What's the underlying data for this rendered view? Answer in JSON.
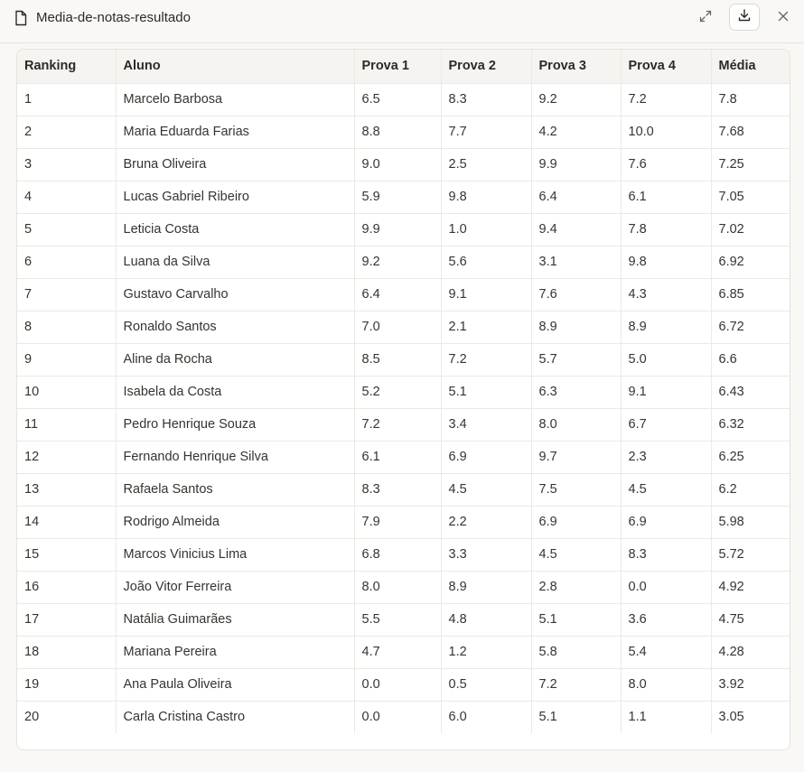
{
  "header": {
    "title": "Media-de-notas-resultado"
  },
  "table": {
    "columns": [
      "Ranking",
      "Aluno",
      "Prova 1",
      "Prova 2",
      "Prova 3",
      "Prova 4",
      "Média"
    ],
    "rows": [
      [
        "1",
        "Marcelo Barbosa",
        "6.5",
        "8.3",
        "9.2",
        "7.2",
        "7.8"
      ],
      [
        "2",
        "Maria Eduarda Farias",
        "8.8",
        "7.7",
        "4.2",
        "10.0",
        "7.68"
      ],
      [
        "3",
        "Bruna Oliveira",
        "9.0",
        "2.5",
        "9.9",
        "7.6",
        "7.25"
      ],
      [
        "4",
        "Lucas Gabriel Ribeiro",
        "5.9",
        "9.8",
        "6.4",
        "6.1",
        "7.05"
      ],
      [
        "5",
        "Leticia Costa",
        "9.9",
        "1.0",
        "9.4",
        "7.8",
        "7.02"
      ],
      [
        "6",
        "Luana da Silva",
        "9.2",
        "5.6",
        "3.1",
        "9.8",
        "6.92"
      ],
      [
        "7",
        "Gustavo Carvalho",
        "6.4",
        "9.1",
        "7.6",
        "4.3",
        "6.85"
      ],
      [
        "8",
        "Ronaldo Santos",
        "7.0",
        "2.1",
        "8.9",
        "8.9",
        "6.72"
      ],
      [
        "9",
        "Aline da Rocha",
        "8.5",
        "7.2",
        "5.7",
        "5.0",
        "6.6"
      ],
      [
        "10",
        "Isabela da Costa",
        "5.2",
        "5.1",
        "6.3",
        "9.1",
        "6.43"
      ],
      [
        "11",
        "Pedro Henrique Souza",
        "7.2",
        "3.4",
        "8.0",
        "6.7",
        "6.32"
      ],
      [
        "12",
        "Fernando Henrique Silva",
        "6.1",
        "6.9",
        "9.7",
        "2.3",
        "6.25"
      ],
      [
        "13",
        "Rafaela Santos",
        "8.3",
        "4.5",
        "7.5",
        "4.5",
        "6.2"
      ],
      [
        "14",
        "Rodrigo Almeida",
        "7.9",
        "2.2",
        "6.9",
        "6.9",
        "5.98"
      ],
      [
        "15",
        "Marcos Vinicius Lima",
        "6.8",
        "3.3",
        "4.5",
        "8.3",
        "5.72"
      ],
      [
        "16",
        "João Vitor Ferreira",
        "8.0",
        "8.9",
        "2.8",
        "0.0",
        "4.92"
      ],
      [
        "17",
        "Natália Guimarães",
        "5.5",
        "4.8",
        "5.1",
        "3.6",
        "4.75"
      ],
      [
        "18",
        "Mariana Pereira",
        "4.7",
        "1.2",
        "5.8",
        "5.4",
        "4.28"
      ],
      [
        "19",
        "Ana Paula Oliveira",
        "0.0",
        "0.5",
        "7.2",
        "8.0",
        "3.92"
      ],
      [
        "20",
        "Carla Cristina Castro",
        "0.0",
        "6.0",
        "5.1",
        "1.1",
        "3.05"
      ]
    ]
  },
  "icons": {
    "file": "file-icon",
    "expand": "expand-icon",
    "download": "download-icon",
    "close": "close-icon"
  }
}
